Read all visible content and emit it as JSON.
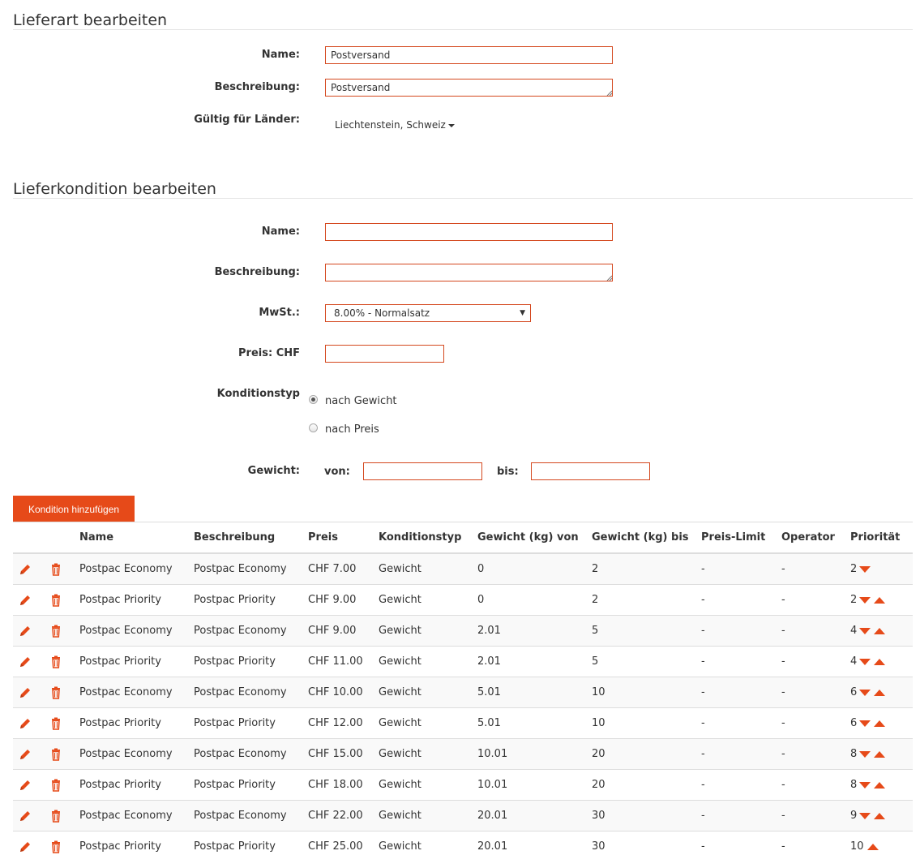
{
  "section1": {
    "title": "Lieferart bearbeiten",
    "name_label": "Name:",
    "name_value": "Postversand",
    "desc_label": "Beschreibung:",
    "desc_value": "Postversand",
    "countries_label": "Gültig für Länder:",
    "countries_value": "Liechtenstein, Schweiz"
  },
  "section2": {
    "title": "Lieferkondition bearbeiten",
    "name_label": "Name:",
    "name_value": "",
    "desc_label": "Beschreibung:",
    "desc_value": "",
    "vat_label": "MwSt.:",
    "vat_selected": "8.00% - Normalsatz",
    "price_label": "Preis: CHF",
    "price_value": "",
    "type_label": "Konditionstyp",
    "type_options": [
      "nach Gewicht",
      "nach Preis"
    ],
    "type_selected": "nach Gewicht",
    "weight_label": "Gewicht:",
    "from_label": "von:",
    "to_label": "bis:",
    "from_value": "",
    "to_value": "",
    "add_button": "Kondition hinzufügen"
  },
  "table": {
    "headers": [
      "Name",
      "Beschreibung",
      "Preis",
      "Konditionstyp",
      "Gewicht (kg) von",
      "Gewicht (kg) bis",
      "Preis-Limit",
      "Operator",
      "Priorität"
    ],
    "rows": [
      {
        "name": "Postpac Economy",
        "desc": "Postpac Economy",
        "price": "CHF 7.00",
        "type": "Gewicht",
        "from": "0",
        "to": "2",
        "limit": "-",
        "op": "-",
        "prio": "2",
        "down": true,
        "up": false
      },
      {
        "name": "Postpac Priority",
        "desc": "Postpac Priority",
        "price": "CHF 9.00",
        "type": "Gewicht",
        "from": "0",
        "to": "2",
        "limit": "-",
        "op": "-",
        "prio": "2",
        "down": true,
        "up": true
      },
      {
        "name": "Postpac Economy",
        "desc": "Postpac Economy",
        "price": "CHF 9.00",
        "type": "Gewicht",
        "from": "2.01",
        "to": "5",
        "limit": "-",
        "op": "-",
        "prio": "4",
        "down": true,
        "up": true
      },
      {
        "name": "Postpac Priority",
        "desc": "Postpac Priority",
        "price": "CHF 11.00",
        "type": "Gewicht",
        "from": "2.01",
        "to": "5",
        "limit": "-",
        "op": "-",
        "prio": "4",
        "down": true,
        "up": true
      },
      {
        "name": "Postpac Economy",
        "desc": "Postpac Economy",
        "price": "CHF 10.00",
        "type": "Gewicht",
        "from": "5.01",
        "to": "10",
        "limit": "-",
        "op": "-",
        "prio": "6",
        "down": true,
        "up": true
      },
      {
        "name": "Postpac Priority",
        "desc": "Postpac Priority",
        "price": "CHF 12.00",
        "type": "Gewicht",
        "from": "5.01",
        "to": "10",
        "limit": "-",
        "op": "-",
        "prio": "6",
        "down": true,
        "up": true
      },
      {
        "name": "Postpac Economy",
        "desc": "Postpac Economy",
        "price": "CHF 15.00",
        "type": "Gewicht",
        "from": "10.01",
        "to": "20",
        "limit": "-",
        "op": "-",
        "prio": "8",
        "down": true,
        "up": true
      },
      {
        "name": "Postpac Priority",
        "desc": "Postpac Priority",
        "price": "CHF 18.00",
        "type": "Gewicht",
        "from": "10.01",
        "to": "20",
        "limit": "-",
        "op": "-",
        "prio": "8",
        "down": true,
        "up": true
      },
      {
        "name": "Postpac Economy",
        "desc": "Postpac Economy",
        "price": "CHF 22.00",
        "type": "Gewicht",
        "from": "20.01",
        "to": "30",
        "limit": "-",
        "op": "-",
        "prio": "9",
        "down": true,
        "up": true
      },
      {
        "name": "Postpac Priority",
        "desc": "Postpac Priority",
        "price": "CHF 25.00",
        "type": "Gewicht",
        "from": "20.01",
        "to": "30",
        "limit": "-",
        "op": "-",
        "prio": "10",
        "down": false,
        "up": true
      }
    ]
  },
  "colors": {
    "accent": "#e64a19",
    "input_border": "#d4481e"
  }
}
